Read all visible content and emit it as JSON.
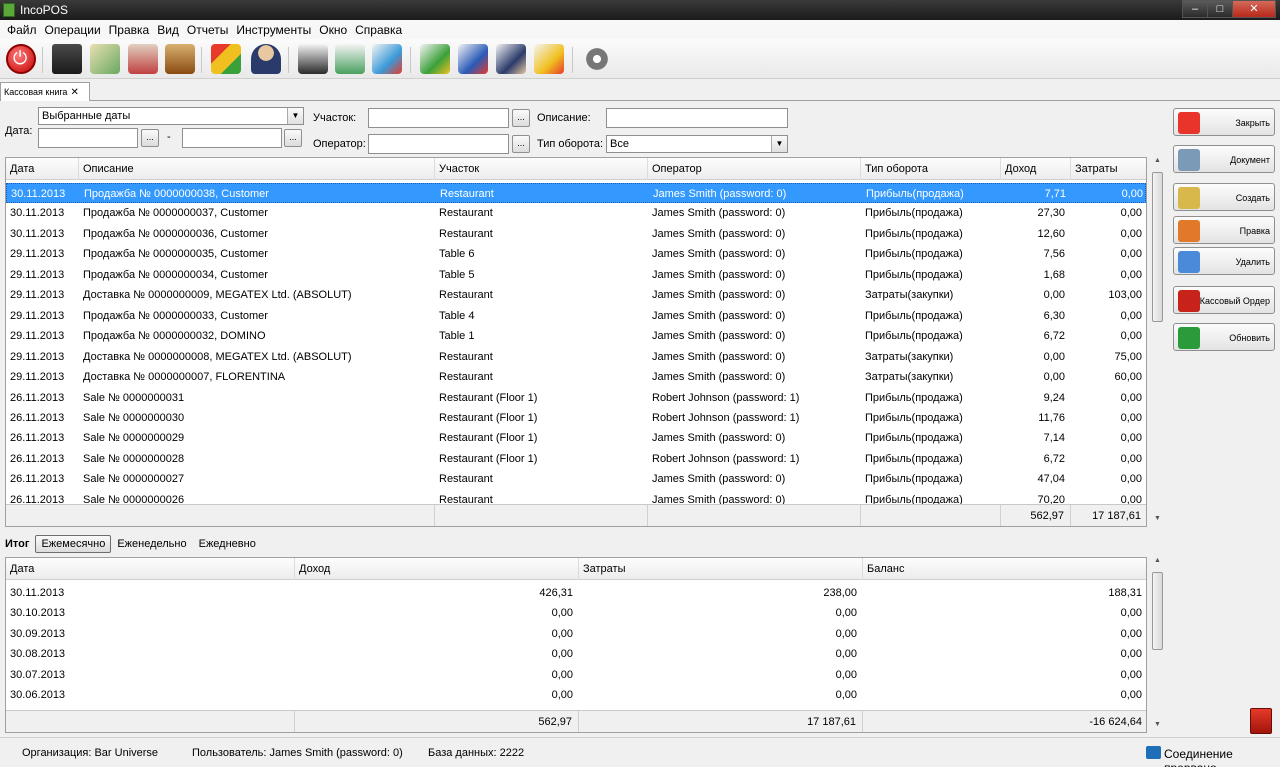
{
  "window": {
    "title": "IncoPOS",
    "controls": [
      "–",
      "□",
      "✕"
    ]
  },
  "menu": [
    "Файл",
    "Операции",
    "Правка",
    "Вид",
    "Отчеты",
    "Инструменты",
    "Окно",
    "Справка"
  ],
  "toolbar": {
    "icons": [
      "power-icon",
      "cash-register-icon",
      "price-tag-icon",
      "stamp-icon",
      "book-icon",
      "blocks-icon",
      "user-icon",
      "doc-box-icon",
      "doc-dollar-icon",
      "doc-blocks-icon",
      "doc-transfer-icon",
      "doc-list-icon",
      "doc-user-icon",
      "doc-report-icon",
      "settings-gear-icon"
    ],
    "colors": {
      "power": "#c40000"
    }
  },
  "tab": {
    "label": "Кассовая книга",
    "close": "✕"
  },
  "filters": {
    "date_label": "Дата:",
    "date_mode": "Выбранные даты",
    "date_from": "",
    "date_to": "",
    "dash": "-",
    "dots": "...",
    "location_label": "Участок:",
    "location_value": "",
    "operator_label": "Оператор:",
    "operator_value": "",
    "description_label": "Описание:",
    "description_value": "",
    "turnover_label": "Тип оборота:",
    "turnover_value": "Все"
  },
  "main_table": {
    "columns": [
      "Дата",
      "Описание",
      "Участок",
      "Оператор",
      "Тип оборота",
      "Доход",
      "Затраты"
    ],
    "rows": [
      [
        "30.11.2013",
        "Продажба № 0000000038, Customer",
        "Restaurant",
        "James Smith (password: 0)",
        "Прибыль(продажа)",
        "7,71",
        "0,00"
      ],
      [
        "30.11.2013",
        "Продажба № 0000000037, Customer",
        "Restaurant",
        "James Smith (password: 0)",
        "Прибыль(продажа)",
        "27,30",
        "0,00"
      ],
      [
        "30.11.2013",
        "Продажба № 0000000036, Customer",
        "Restaurant",
        "James Smith (password: 0)",
        "Прибыль(продажа)",
        "12,60",
        "0,00"
      ],
      [
        "29.11.2013",
        "Продажба № 0000000035, Customer",
        "Table 6",
        "James Smith (password: 0)",
        "Прибыль(продажа)",
        "7,56",
        "0,00"
      ],
      [
        "29.11.2013",
        "Продажба № 0000000034, Customer",
        "Table 5",
        "James Smith (password: 0)",
        "Прибыль(продажа)",
        "1,68",
        "0,00"
      ],
      [
        "29.11.2013",
        "Доставка № 0000000009, MEGATEX Ltd. (ABSOLUT)",
        "Restaurant",
        "James Smith (password: 0)",
        "Затраты(закупки)",
        "0,00",
        "103,00"
      ],
      [
        "29.11.2013",
        "Продажба № 0000000033, Customer",
        "Table 4",
        "James Smith (password: 0)",
        "Прибыль(продажа)",
        "6,30",
        "0,00"
      ],
      [
        "29.11.2013",
        "Продажба № 0000000032, DOMINO",
        "Table 1",
        "James Smith (password: 0)",
        "Прибыль(продажа)",
        "6,72",
        "0,00"
      ],
      [
        "29.11.2013",
        "Доставка № 0000000008, MEGATEX Ltd. (ABSOLUT)",
        "Restaurant",
        "James Smith (password: 0)",
        "Затраты(закупки)",
        "0,00",
        "75,00"
      ],
      [
        "29.11.2013",
        "Доставка № 0000000007, FLORENTINA",
        "Restaurant",
        "James Smith (password: 0)",
        "Затраты(закупки)",
        "0,00",
        "60,00"
      ],
      [
        "26.11.2013",
        "Sale № 0000000031",
        "Restaurant (Floor 1)",
        "Robert Johnson (password: 1)",
        "Прибыль(продажа)",
        "9,24",
        "0,00"
      ],
      [
        "26.11.2013",
        "Sale № 0000000030",
        "Restaurant (Floor 1)",
        "Robert Johnson (password: 1)",
        "Прибыль(продажа)",
        "11,76",
        "0,00"
      ],
      [
        "26.11.2013",
        "Sale № 0000000029",
        "Restaurant (Floor 1)",
        "James Smith (password: 0)",
        "Прибыль(продажа)",
        "7,14",
        "0,00"
      ],
      [
        "26.11.2013",
        "Sale № 0000000028",
        "Restaurant (Floor 1)",
        "Robert Johnson (password: 1)",
        "Прибыль(продажа)",
        "6,72",
        "0,00"
      ],
      [
        "26.11.2013",
        "Sale № 0000000027",
        "Restaurant",
        "James Smith (password: 0)",
        "Прибыль(продажа)",
        "47,04",
        "0,00"
      ],
      [
        "26.11.2013",
        "Sale № 0000000026",
        "Restaurant",
        "James Smith (password: 0)",
        "Прибыль(продажа)",
        "70,20",
        "0,00"
      ]
    ],
    "totals": {
      "income": "562,97",
      "expense": "17 187,61"
    }
  },
  "side_buttons": [
    {
      "label": "Закрыть",
      "color": "#e8342a"
    },
    {
      "label": "Документ",
      "color": "#7a9ab8"
    },
    {
      "label": "Создать",
      "color": "#d8b84a"
    },
    {
      "label": "Правка",
      "color": "#e07a2a"
    },
    {
      "label": "Удалить",
      "color": "#4a8ad8"
    },
    {
      "label": "Кассовый Ордер",
      "color": "#c8231a"
    },
    {
      "label": "Обновить",
      "color": "#2a9a3a"
    }
  ],
  "summary": {
    "title": "Итог",
    "tabs": [
      "Ежемесячно",
      "Еженедельно",
      "Ежедневно"
    ],
    "active_tab": 0,
    "columns": [
      "Дата",
      "Доход",
      "Затраты",
      "Баланс"
    ],
    "rows": [
      [
        "30.11.2013",
        "426,31",
        "238,00",
        "188,31"
      ],
      [
        "30.10.2013",
        "0,00",
        "0,00",
        "0,00"
      ],
      [
        "30.09.2013",
        "0,00",
        "0,00",
        "0,00"
      ],
      [
        "30.08.2013",
        "0,00",
        "0,00",
        "0,00"
      ],
      [
        "30.07.2013",
        "0,00",
        "0,00",
        "0,00"
      ],
      [
        "30.06.2013",
        "0,00",
        "0,00",
        "0,00"
      ]
    ],
    "totals": {
      "income": "562,97",
      "expense": "17 187,61",
      "balance": "-16 624,64"
    }
  },
  "status": {
    "organization": "Организация: Bar Universe",
    "user": "Пользователь: James Smith (password: 0)",
    "database": "База данных: 2222",
    "connection": "Соединение прервано"
  }
}
